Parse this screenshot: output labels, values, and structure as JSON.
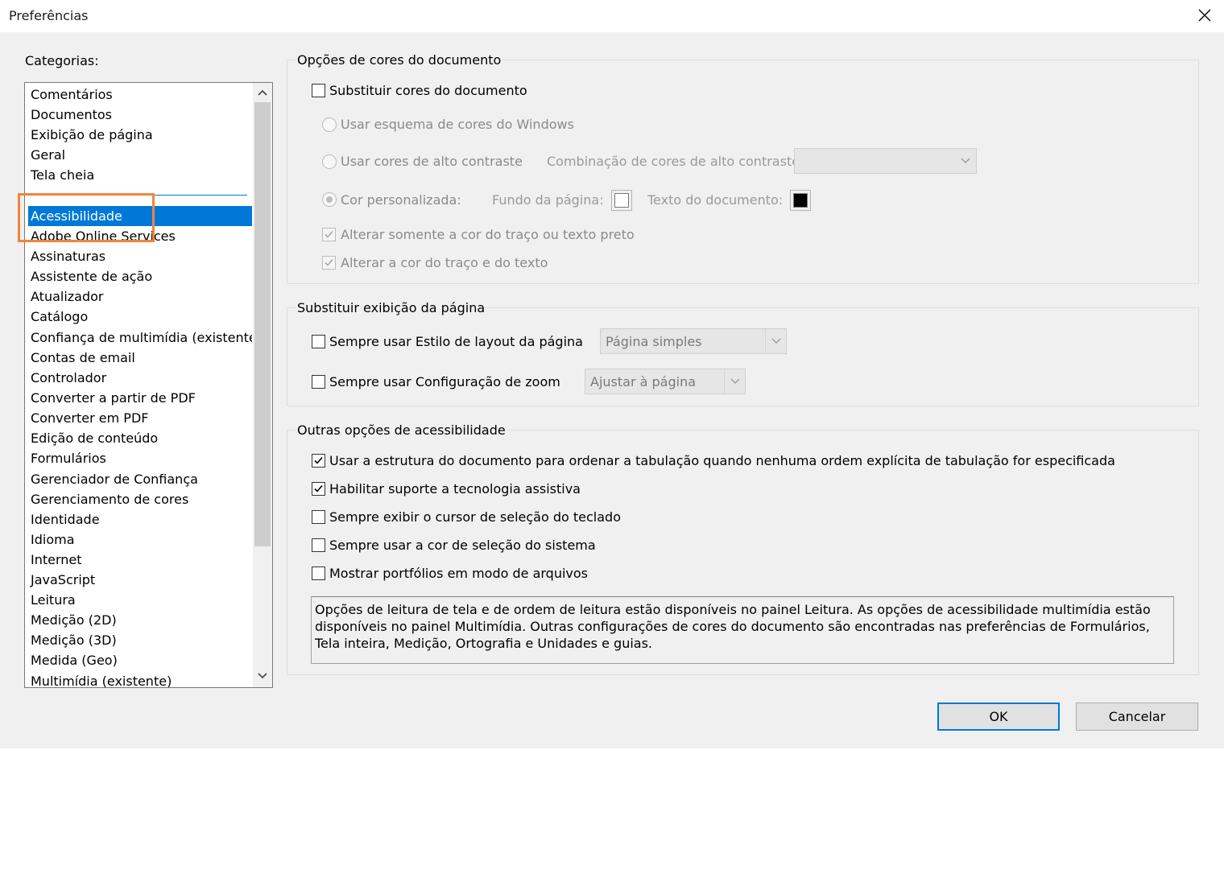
{
  "window": {
    "title": "Preferências"
  },
  "categories": {
    "label": "Categorias:",
    "top_items": [
      "Comentários",
      "Documentos",
      "Exibição de página",
      "Geral",
      "Tela cheia"
    ],
    "items": [
      "Acessibilidade",
      "Adobe Online Services",
      "Assinaturas",
      "Assistente de ação",
      "Atualizador",
      "Catálogo",
      "Confiança de multimídia (existente)",
      "Contas de email",
      "Controlador",
      "Converter a partir de PDF",
      "Converter em PDF",
      "Edição de conteúdo",
      "Formulários",
      "Gerenciador de Confiança",
      "Gerenciamento de cores",
      "Identidade",
      "Idioma",
      "Internet",
      "JavaScript",
      "Leitura",
      "Medição (2D)",
      "Medição (3D)",
      "Medida (Geo)",
      "Multimídia (existente)"
    ],
    "selected": "Acessibilidade"
  },
  "doc_colors": {
    "title": "Opções de cores do documento",
    "replace_colors": "Substituir cores do documento",
    "windows_scheme": "Usar esquema de cores do Windows",
    "high_contrast": "Usar cores de alto contraste",
    "high_contrast_combo_label": "Combinação de cores de alto contraste:",
    "high_contrast_combo_value": "",
    "custom_color": "Cor personalizada:",
    "page_background": "Fundo da página:",
    "document_text": "Texto do documento:",
    "page_background_color": "#ffffff",
    "document_text_color": "#000000",
    "change_black_only": "Alterar somente a cor do traço ou texto preto",
    "change_line_text": "Alterar a cor do traço e do texto"
  },
  "page_display": {
    "title": "Substituir exibição da página",
    "always_layout": "Sempre usar Estilo de layout da página",
    "layout_value": "Página simples",
    "always_zoom": "Sempre usar Configuração de zoom",
    "zoom_value": "Ajustar à página"
  },
  "other_options": {
    "title": "Outras opções de acessibilidade",
    "tab_order": "Usar a estrutura do documento para ordenar a tabulação quando nenhuma ordem explícita de tabulação for especificada",
    "assistive": "Habilitar suporte a tecnologia assistiva",
    "keyboard_cursor": "Sempre exibir o cursor de seleção do teclado",
    "system_selection": "Sempre usar a cor de seleção do sistema",
    "portfolios": "Mostrar portfólios em modo de arquivos",
    "info": "Opções de leitura de tela e de ordem de leitura estão disponíveis no painel Leitura. As opções de acessibilidade multimídia estão disponíveis no painel Multimídia. Outras configurações de cores do documento são encontradas nas preferências de Formulários, Tela inteira, Medição, Ortografia e Unidades e guias."
  },
  "buttons": {
    "ok": "OK",
    "cancel": "Cancelar"
  },
  "colors": {
    "accent": "#0078d7",
    "highlight": "#f0843c"
  }
}
